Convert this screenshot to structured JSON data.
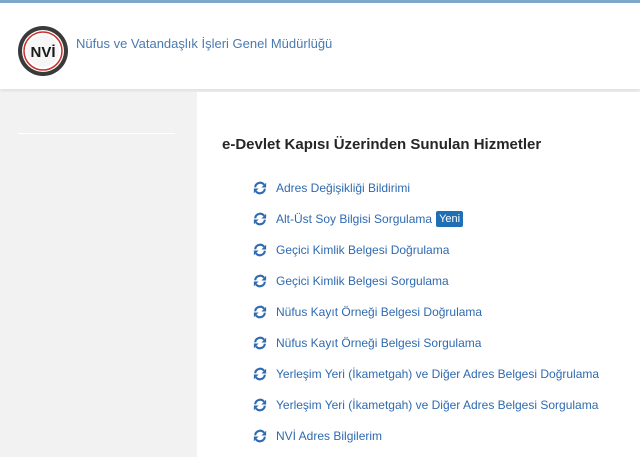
{
  "header": {
    "logo_text": "NVİ",
    "org_name": "Nüfus ve Vatandaşlık İşleri Genel Müdürlüğü"
  },
  "main": {
    "section_title": "e-Devlet Kapısı Üzerinden Sunulan Hizmetler",
    "services": [
      {
        "label": "Adres Değişikliği Bildirimi",
        "icon": "refresh-icon"
      },
      {
        "label": "Alt-Üst Soy Bilgisi Sorgulama",
        "icon": "refresh-icon",
        "badge": "Yeni"
      },
      {
        "label": "Geçici Kimlik Belgesi Doğrulama",
        "icon": "refresh-icon"
      },
      {
        "label": "Geçici Kimlik Belgesi Sorgulama",
        "icon": "refresh-icon"
      },
      {
        "label": "Nüfus Kayıt Örneği Belgesi Doğrulama",
        "icon": "refresh-icon"
      },
      {
        "label": "Nüfus Kayıt Örneği Belgesi Sorgulama",
        "icon": "refresh-icon"
      },
      {
        "label": "Yerleşim Yeri (İkametgah) ve Diğer Adres Belgesi Doğrulama",
        "icon": "refresh-icon"
      },
      {
        "label": "Yerleşim Yeri (İkametgah) ve Diğer Adres Belgesi Sorgulama",
        "icon": "refresh-icon"
      },
      {
        "label": "NVİ Adres Bilgilerim",
        "icon": "refresh-icon"
      }
    ]
  },
  "colors": {
    "link": "#2f6ab0",
    "badge": "#1f6fb5",
    "title": "#262626",
    "org_text": "#4a7ab0"
  }
}
